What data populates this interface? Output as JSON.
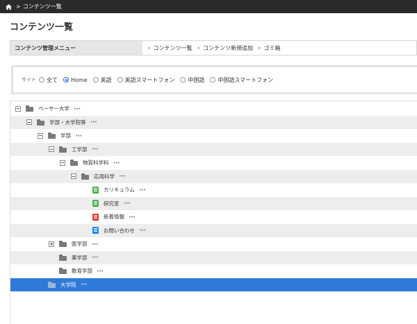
{
  "breadcrumb": {
    "home_icon": "home-icon",
    "separator": ">",
    "current": "コンテンツ一覧"
  },
  "page": {
    "title": "コンテンツ一覧"
  },
  "menu": {
    "label": "コンテンツ管理メニュー",
    "links": [
      "コンテンツ一覧",
      "コンテンツ新規追加",
      "ゴミ箱"
    ]
  },
  "site": {
    "label": "サイト",
    "selected": "Home",
    "options": [
      "全て",
      "Home",
      "英語",
      "英語スマートフォン",
      "中国語",
      "中国語スマートフォン"
    ]
  },
  "tree": {
    "more_glyph": "•••",
    "rows": [
      {
        "label": "ベーサー大学",
        "depth": 0,
        "toggle": "minus",
        "icon": "folder-icon"
      },
      {
        "label": "学部・大学院等",
        "depth": 1,
        "toggle": "minus",
        "icon": "folder-icon"
      },
      {
        "label": "学部",
        "depth": 2,
        "toggle": "minus",
        "icon": "folder-icon"
      },
      {
        "label": "工学部",
        "depth": 3,
        "toggle": "minus",
        "icon": "folder-icon"
      },
      {
        "label": "物質科学科",
        "depth": 4,
        "toggle": "minus",
        "icon": "folder-icon"
      },
      {
        "label": "応用科学",
        "depth": 5,
        "toggle": "minus",
        "icon": "folder-icon"
      },
      {
        "label": "カリキュラム",
        "depth": 6,
        "toggle": "none",
        "icon": "page-green-icon"
      },
      {
        "label": "研究室",
        "depth": 6,
        "toggle": "none",
        "icon": "page-green-icon"
      },
      {
        "label": "新着情報",
        "depth": 6,
        "toggle": "none",
        "icon": "page-red-icon"
      },
      {
        "label": "お問い合わせ",
        "depth": 6,
        "toggle": "none",
        "icon": "page-blue-icon"
      },
      {
        "label": "医学部",
        "depth": 3,
        "toggle": "plus",
        "icon": "folder-icon"
      },
      {
        "label": "薬学部",
        "depth": 3,
        "toggle": "none",
        "icon": "folder-icon"
      },
      {
        "label": "教育学部",
        "depth": 3,
        "toggle": "none",
        "icon": "folder-icon"
      },
      {
        "label": "大学院",
        "depth": 2,
        "toggle": "none",
        "icon": "folder-icon",
        "selected": true
      }
    ]
  }
}
